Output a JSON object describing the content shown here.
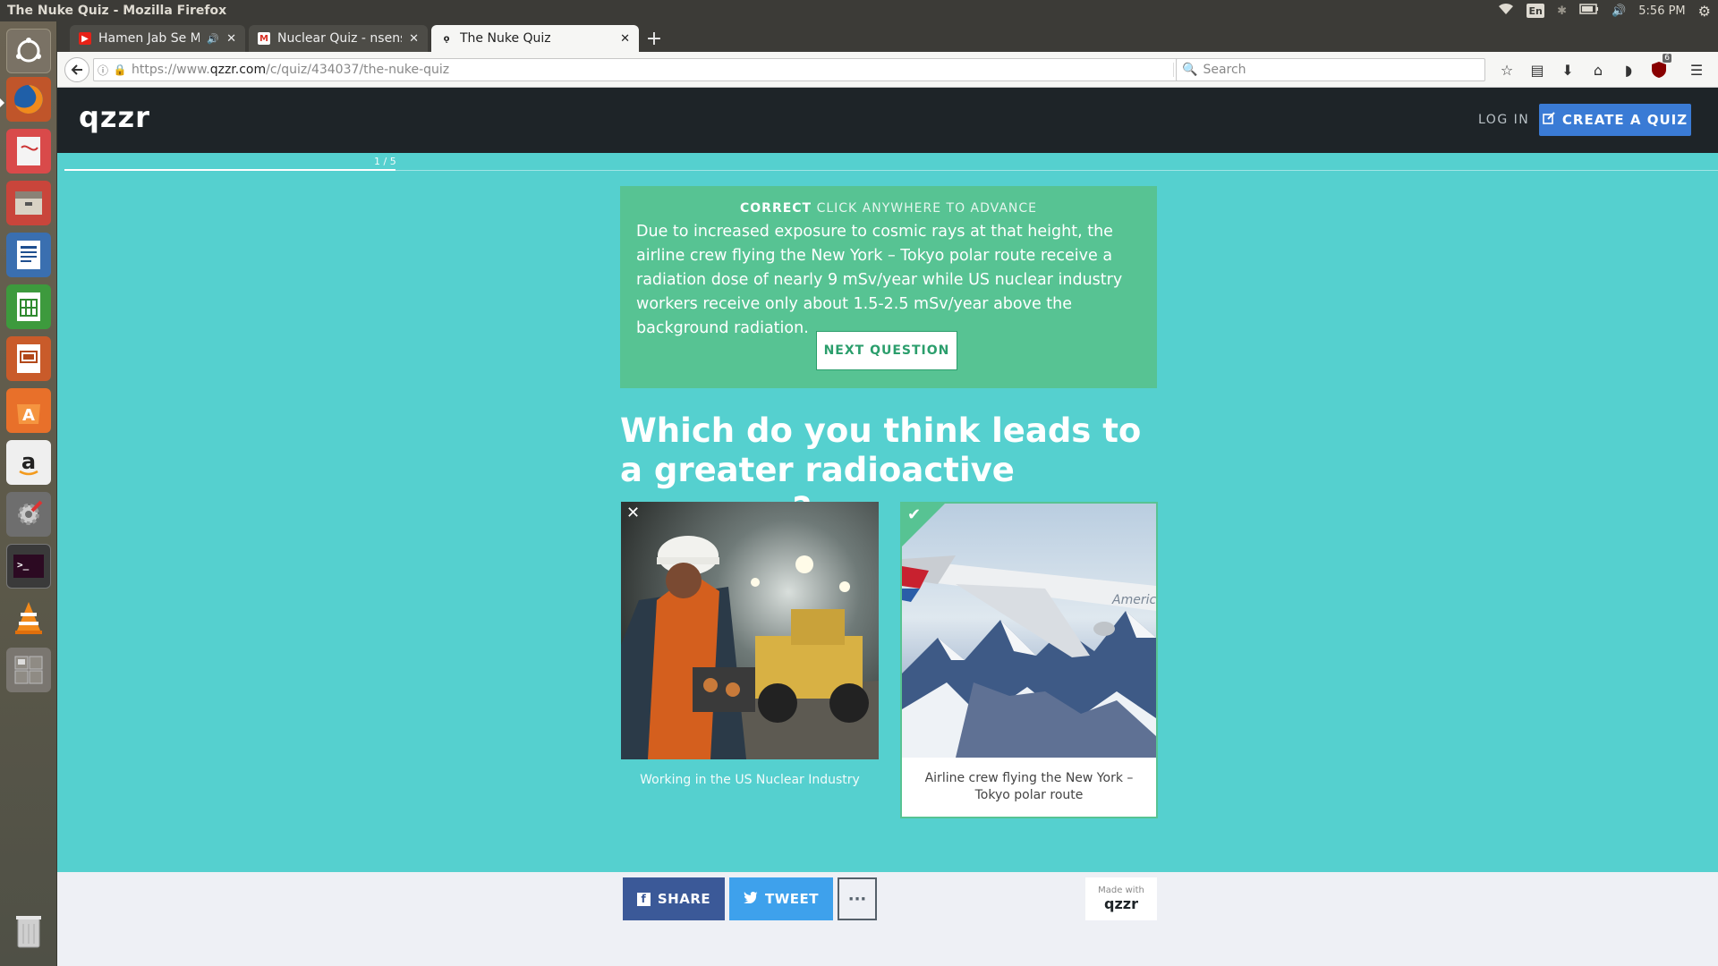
{
  "os_panel": {
    "window_title": "The Nuke Quiz - Mozilla Firefox",
    "keyboard_layout": "En",
    "clock": "5:56 PM"
  },
  "launcher": {
    "apps": [
      "ubuntu-dash",
      "firefox",
      "text-editor",
      "files",
      "writer",
      "calc",
      "impress",
      "software-center",
      "amazon",
      "system-settings",
      "terminal",
      "vlc",
      "workspaces",
      "trash"
    ]
  },
  "browser": {
    "tabs": [
      {
        "label": "Hamen Jab Se Mohabbat",
        "icon": "youtube-icon",
        "muted_icon": "speaker-icon"
      },
      {
        "label": "Nuclear Quiz - nsensha",
        "icon": "gmail-icon"
      },
      {
        "label": "The Nuke Quiz",
        "icon": "qzzr-icon"
      }
    ],
    "url_prefix": "https://www.",
    "url_host": "qzzr.com",
    "url_path": "/c/quiz/434037/the-nuke-quiz",
    "search_placeholder": "Search",
    "ublock_badge": "6"
  },
  "site": {
    "logo": "qzzr",
    "login_label": "LOG IN",
    "create_label": "CREATE A QUIZ",
    "progress_label": "1 / 5",
    "progress_fraction": 0.2
  },
  "feedback": {
    "status": "CORRECT",
    "advance": "CLICK ANYWHERE TO ADVANCE",
    "explanation": "Due to increased exposure to cosmic rays at that height, the airline crew flying the New York – Tokyo polar route receive a radiation dose of nearly 9 mSv/year while US nuclear industry workers receive only about 1.5-2.5 mSv/year above the background radiation.",
    "next_label": "NEXT QUESTION"
  },
  "question": {
    "text": "Which do you think leads to a greater radioactive exposure?",
    "answers": [
      {
        "caption": "Working in the US Nuclear Industry",
        "state": "wrong"
      },
      {
        "caption": "Airline crew flying the New York – Tokyo polar route",
        "state": "correct",
        "tail_text": "American"
      }
    ]
  },
  "footer": {
    "share_label": "SHARE",
    "tweet_label": "TWEET",
    "more_label": "···",
    "made_with": "Made with",
    "made_with_logo": "qzzr"
  },
  "colors": {
    "page_bg": "#55d0cf",
    "feedback_bg": "#57c393",
    "header_bg": "#1e2428",
    "create_btn": "#3a7bd5",
    "facebook": "#3b5998",
    "twitter": "#3ea1ec"
  }
}
